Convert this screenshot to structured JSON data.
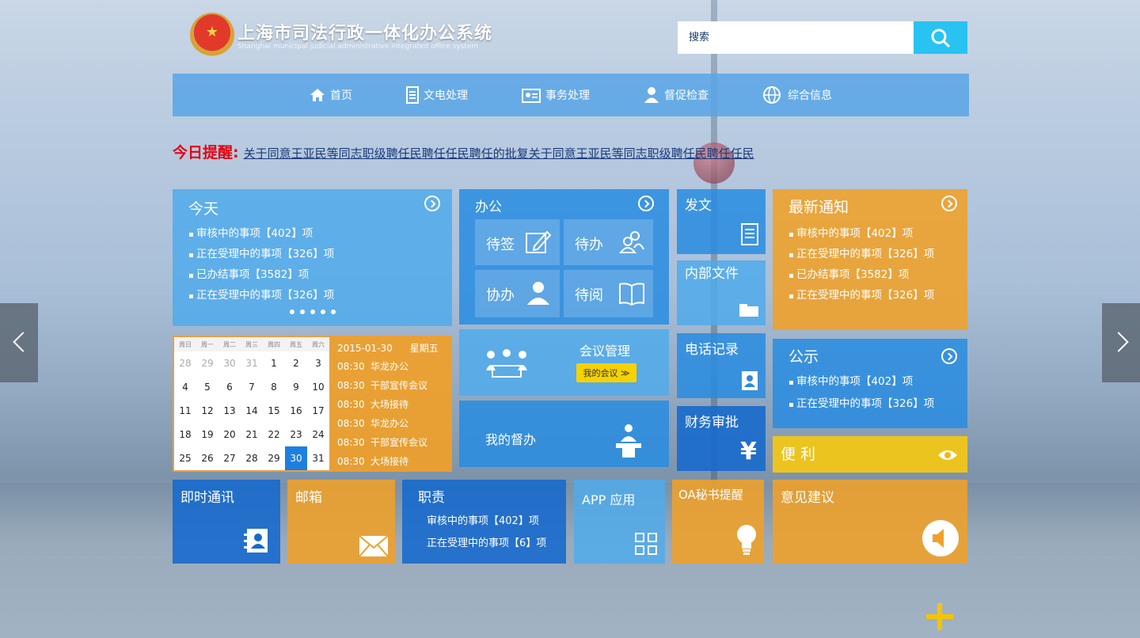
{
  "header": {
    "title": "上海市司法行政一体化办公系统",
    "subtitle": "Shanghai municipal judicial administrative integrated office system",
    "search_placeholder": "搜索"
  },
  "nav": [
    {
      "label": "首页",
      "icon": "home-icon"
    },
    {
      "label": "文电处理",
      "icon": "document-icon"
    },
    {
      "label": "事务处理",
      "icon": "id-card-icon"
    },
    {
      "label": "督促检查",
      "icon": "user-icon"
    },
    {
      "label": "综合信息",
      "icon": "globe-icon"
    }
  ],
  "notice": {
    "label": "今日提醒:",
    "text": "关于同意王亚民等同志职级聘任民聘任任民聘任的批复关于同意王亚民等同志职级聘任民聘任任民"
  },
  "today": {
    "title": "今天",
    "items": [
      "审核中的事项【402】项",
      "正在受理中的事项【326】项",
      "已办结事项【3582】项",
      "正在受理中的事项【326】项"
    ]
  },
  "office": {
    "title": "办公",
    "subs": [
      "待签",
      "待办",
      "协办",
      "待阅"
    ]
  },
  "meeting": {
    "title": "会议管理",
    "button": "我的会议 ≫"
  },
  "supervise": {
    "title": "我的督办"
  },
  "fawen": {
    "title": "发文"
  },
  "internal": {
    "title": "内部文件"
  },
  "phone": {
    "title": "电话记录"
  },
  "finance": {
    "title": "财务审批"
  },
  "latest": {
    "title": "最新通知",
    "items": [
      "审核中的事项【402】项",
      "正在受理中的事项【326】项",
      "已办结事项【3582】项",
      "正在受理中的事项【326】项"
    ]
  },
  "publicity": {
    "title": "公示",
    "items": [
      "审核中的事项【402】项",
      "正在受理中的事项【326】项"
    ]
  },
  "convenience": {
    "title": "便 利"
  },
  "calendar": {
    "weekdays": [
      "周日",
      "周一",
      "周二",
      "周三",
      "周四",
      "周五",
      "周六"
    ],
    "weeks": [
      [
        "28",
        "29",
        "30",
        "31",
        "1",
        "2",
        "3"
      ],
      [
        "4",
        "5",
        "6",
        "7",
        "8",
        "9",
        "10"
      ],
      [
        "11",
        "12",
        "13",
        "14",
        "15",
        "16",
        "17"
      ],
      [
        "18",
        "19",
        "20",
        "21",
        "22",
        "23",
        "24"
      ],
      [
        "25",
        "26",
        "27",
        "28",
        "29",
        "30",
        "31"
      ]
    ],
    "date": "2015-01-30",
    "weekday": "星期五",
    "schedule": [
      {
        "time": "08:30",
        "event": "华龙办公"
      },
      {
        "time": "08:30",
        "event": "干部宣传会议"
      },
      {
        "time": "08:30",
        "event": "大场接待"
      },
      {
        "time": "08:30",
        "event": "华龙办公"
      },
      {
        "time": "08:30",
        "event": "干部宣传会议"
      },
      {
        "time": "08:30",
        "event": "大场接待"
      }
    ]
  },
  "im": {
    "title": "即时通讯"
  },
  "mail": {
    "title": "邮箱"
  },
  "duty": {
    "title": "职责",
    "items": [
      "审核中的事项【402】项",
      "正在受理中的事项【6】项"
    ]
  },
  "app": {
    "title": "APP 应用"
  },
  "oa": {
    "title": "OA秘书提醒"
  },
  "suggest": {
    "title": "意见建议"
  },
  "colors": {
    "accent": "#28c3f0",
    "orange": "#f0a028",
    "yellow": "#f5c814",
    "blue": "#1469cd"
  }
}
